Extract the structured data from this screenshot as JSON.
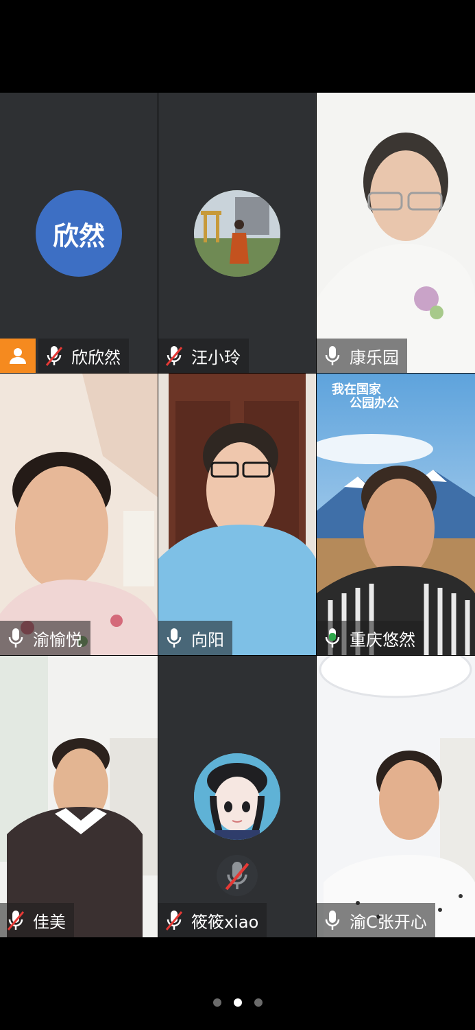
{
  "participants": [
    {
      "name": "欣欣然",
      "avatar_text": "欣然",
      "mic": "muted",
      "host": true,
      "video": false
    },
    {
      "name": "汪小玲",
      "mic": "muted",
      "video": false
    },
    {
      "name": "康乐园",
      "mic": "on",
      "video": true
    },
    {
      "name": "渝愉悦",
      "mic": "on",
      "video": true
    },
    {
      "name": "向阳",
      "mic": "on",
      "video": true
    },
    {
      "name": "重庆悠然",
      "mic": "speaking",
      "video": true,
      "bg_text_1": "我在国家",
      "bg_text_2": "公园办公"
    },
    {
      "name": "佳美",
      "mic": "muted",
      "video": true
    },
    {
      "name": "筱筱xiao",
      "mic": "muted",
      "video": false
    },
    {
      "name": "渝C张开心",
      "mic": "on",
      "video": true
    }
  ],
  "pagination": {
    "pages": 3,
    "current": 2
  },
  "colors": {
    "tile_bg": "#2e3033",
    "host_badge": "#f58a1f",
    "avatar_blue": "#3d6fc4",
    "speaking_green": "#2ea84a"
  }
}
